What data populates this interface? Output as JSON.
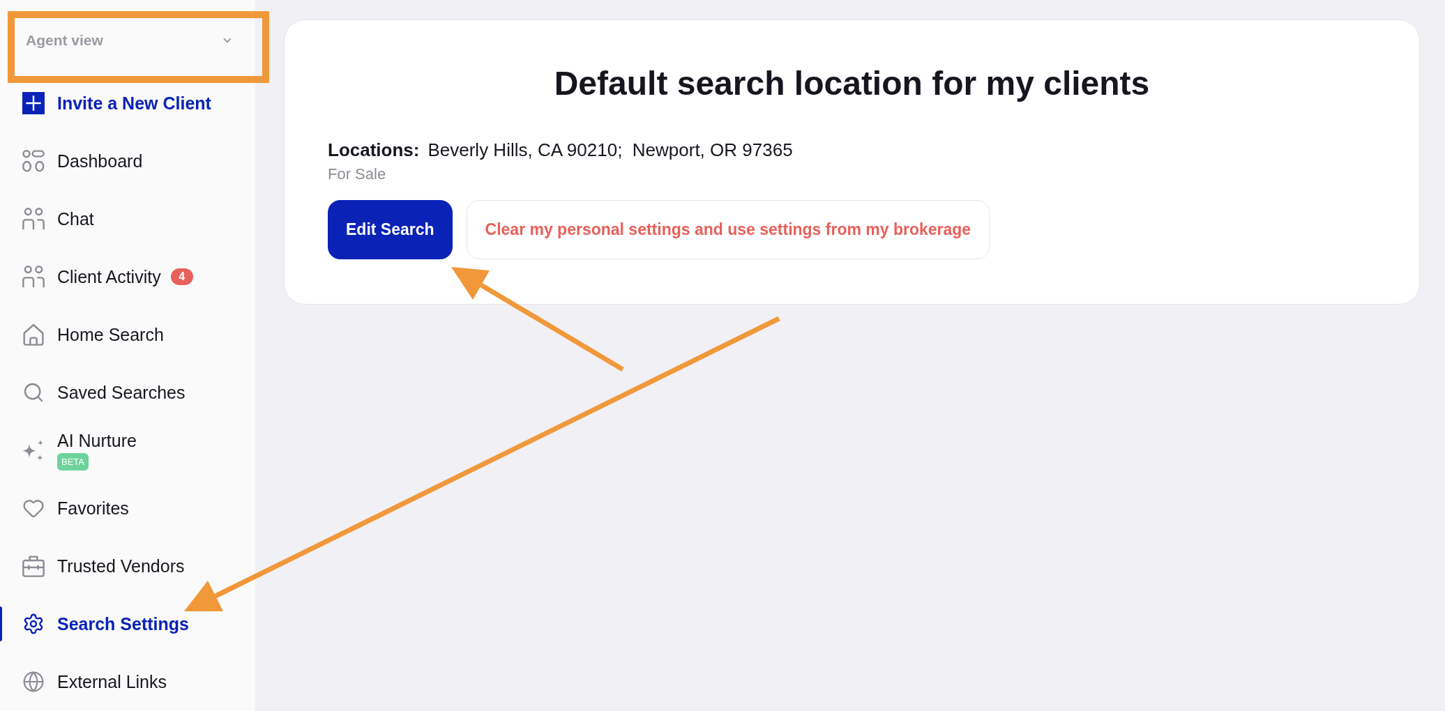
{
  "sidebar": {
    "view_select": {
      "label": "Agent view"
    },
    "items": [
      {
        "label": "Invite a New Client",
        "kind": "action"
      },
      {
        "label": "Dashboard",
        "kind": "link",
        "selected": false
      },
      {
        "label": "Chat",
        "kind": "link",
        "selected": false
      },
      {
        "label": "Client Activity",
        "kind": "link",
        "selected": false,
        "badge": "4"
      },
      {
        "label": "Home Search",
        "kind": "link",
        "selected": false
      },
      {
        "label": "Saved Searches",
        "kind": "link",
        "selected": false
      },
      {
        "label": "AI Nurture",
        "kind": "link",
        "selected": false,
        "tag": "BETA"
      },
      {
        "label": "Favorites",
        "kind": "link",
        "selected": false
      },
      {
        "label": "Trusted Vendors",
        "kind": "link",
        "selected": false
      },
      {
        "label": "Search Settings",
        "kind": "link",
        "selected": true
      },
      {
        "label": "External Links",
        "kind": "link",
        "selected": false
      }
    ]
  },
  "card": {
    "title": "Default search location for my clients",
    "locations": {
      "label": "Locations:",
      "value": "Beverly Hills, CA 90210;  Newport, OR 97365"
    },
    "listing_type": "For Sale",
    "buttons": [
      {
        "label": "Edit Search",
        "kind": "primary"
      },
      {
        "label": "Clear my personal settings and use settings from my brokerage",
        "kind": "outline-danger"
      }
    ]
  }
}
